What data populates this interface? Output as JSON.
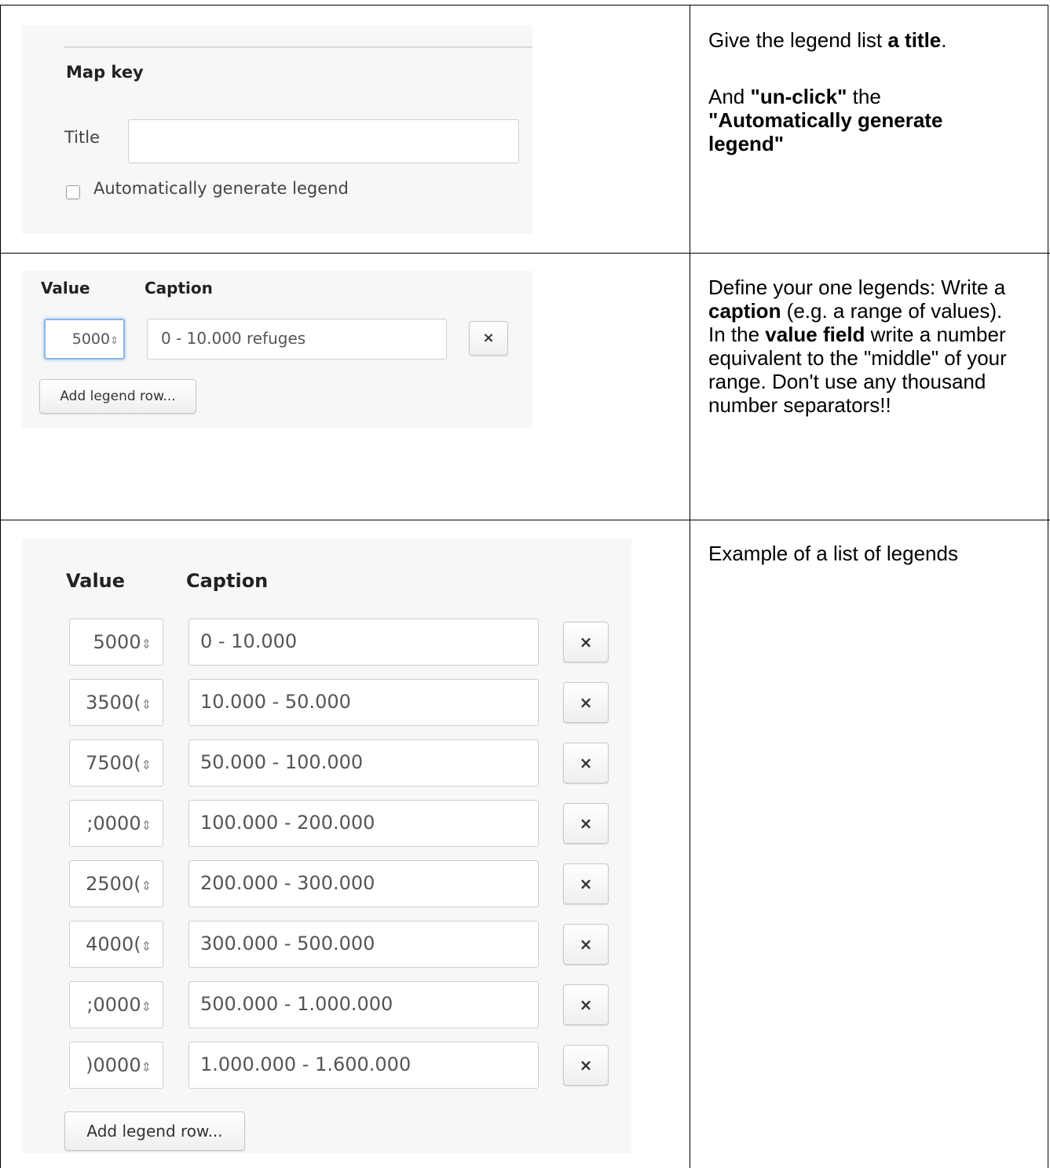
{
  "section1": {
    "map_key_heading": "Map key",
    "title_label": "Title",
    "title_value": "",
    "auto_legend_label": "Automatically generate legend",
    "auto_legend_checked": false,
    "instr_a1": "Give the legend list ",
    "instr_a2": "a title",
    "instr_a3": ".",
    "instr_b1": "And ",
    "instr_b2": "\"un-click\"",
    "instr_b3": " the ",
    "instr_b4": "\"Automatically generate legend\""
  },
  "section2": {
    "value_header": "Value",
    "caption_header": "Caption",
    "row": {
      "value": "5000",
      "caption": "0 - 10.000 refuges"
    },
    "add_row_label": "Add legend row...",
    "remove_symbol": "×",
    "instr_1": "Define your one legends: Write a ",
    "instr_2": "caption",
    "instr_3": " (e.g. a range of values).",
    "instr_4": "In the ",
    "instr_5": "value field",
    "instr_6": " write a number equivalent to the \"middle\" of your range. Don't use any thousand number separators!!"
  },
  "section3": {
    "value_header": "Value",
    "caption_header": "Caption",
    "rows": [
      {
        "value": "5000",
        "caption": "0 - 10.000"
      },
      {
        "value": "3500(",
        "caption": "10.000 - 50.000"
      },
      {
        "value": "7500(",
        "caption": "50.000 - 100.000"
      },
      {
        "value": ";0000",
        "caption": "100.000 - 200.000"
      },
      {
        "value": "2500(",
        "caption": "200.000 - 300.000"
      },
      {
        "value": "4000(",
        "caption": "300.000 - 500.000"
      },
      {
        "value": ";0000",
        "caption": "500.000 - 1.000.000"
      },
      {
        "value": ")0000",
        "caption": "1.000.000 - 1.600.000"
      }
    ],
    "add_row_label": "Add legend row...",
    "remove_symbol": "×",
    "instr": "Example of a list of legends"
  },
  "spinner_glyph": "⇕"
}
